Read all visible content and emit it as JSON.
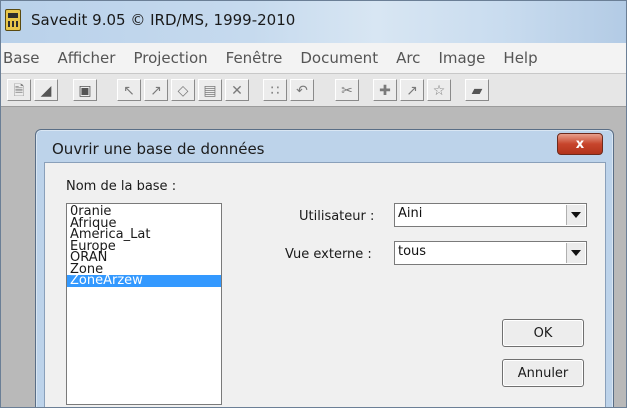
{
  "window": {
    "title": "Savedit 9.05 © IRD/MS, 1999-2010"
  },
  "menubar": {
    "items": [
      "Base",
      "Afficher",
      "Projection",
      "Fenêtre",
      "Document",
      "Arc",
      "Image",
      "Help"
    ]
  },
  "toolbar": {
    "icons": [
      "new-icon",
      "open-icon",
      "save-icon",
      "select-arrow-icon",
      "draw-polyline-icon",
      "polygon-icon",
      "frame-icon",
      "delete-icon",
      "grid-icon",
      "undo-icon",
      "cut-icon",
      "point-icon",
      "node-icon",
      "symbol-icon",
      "fill-icon"
    ]
  },
  "dialog": {
    "title": "Ouvrir une base de données",
    "close_label": "x",
    "base_name_label": "Nom de la base :",
    "bases": [
      "0ranie",
      "Afrique",
      "America_Lat",
      "Europe",
      "ORAN",
      "Zone",
      "ZoneArzew"
    ],
    "selected_base": "ZoneArzew",
    "user_label": "Utilisateur :",
    "user_value": "Aini",
    "external_view_label": "Vue externe :",
    "external_view_value": "tous",
    "ok_label": "OK",
    "cancel_label": "Annuler"
  },
  "colors": {
    "selection": "#3399ff",
    "dialog_frame": "#bdd3ea",
    "close_button": "#c7452c"
  }
}
